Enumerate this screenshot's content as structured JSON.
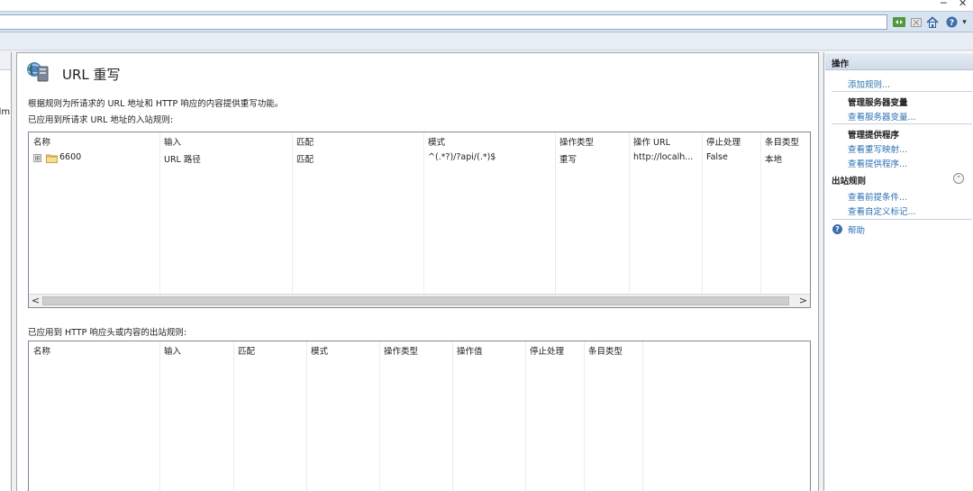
{
  "window": {
    "minimize_glyph": "─",
    "close_glyph": "✕"
  },
  "toolbar": {
    "icons": [
      "back-forward-icon",
      "stop-icon",
      "home-icon",
      "help-icon"
    ],
    "help_dropdown_glyph": "▾"
  },
  "left_pane": {
    "partial_text": "dm"
  },
  "page": {
    "title": "URL 重写",
    "description": "根据规则为所请求的 URL 地址和 HTTP 响应的内容提供重写功能。",
    "inbound_label": "已应用到所请求 URL 地址的入站规则:",
    "outbound_label": "已应用到 HTTP 响应头或内容的出站规则:"
  },
  "inbound_table": {
    "columns": [
      "名称",
      "输入",
      "匹配",
      "模式",
      "操作类型",
      "操作 URL",
      "停止处理",
      "条目类型"
    ],
    "rows": [
      {
        "name": "6600",
        "input": "URL 路径",
        "match": "匹配",
        "pattern": "^(.*?)/?api/(.*)$",
        "action_type": "重写",
        "action_url": "http://localh...",
        "stop_processing": "False",
        "entry_type": "本地"
      }
    ],
    "expander_glyph": "⊞",
    "scroll_left": "<",
    "scroll_right": ">"
  },
  "outbound_table": {
    "columns": [
      "名称",
      "输入",
      "匹配",
      "模式",
      "操作类型",
      "操作值",
      "停止处理",
      "条目类型"
    ],
    "rows": []
  },
  "actions": {
    "header": "操作",
    "add_rule": "添加规则...",
    "server_vars_title": "管理服务器变量",
    "view_server_vars": "查看服务器变量...",
    "providers_title": "管理提供程序",
    "view_rewrite_maps": "查看重写映射...",
    "view_providers": "查看提供程序...",
    "outbound_section": "出站规则",
    "collapse_glyph": "⌃",
    "view_preconditions": "查看前提条件...",
    "view_custom_tags": "查看自定义标记...",
    "help": "帮助"
  },
  "colors": {
    "link": "#2c6fb2",
    "toolbar_band": "#d7e3f0",
    "actions_header": "#d2dcea"
  }
}
